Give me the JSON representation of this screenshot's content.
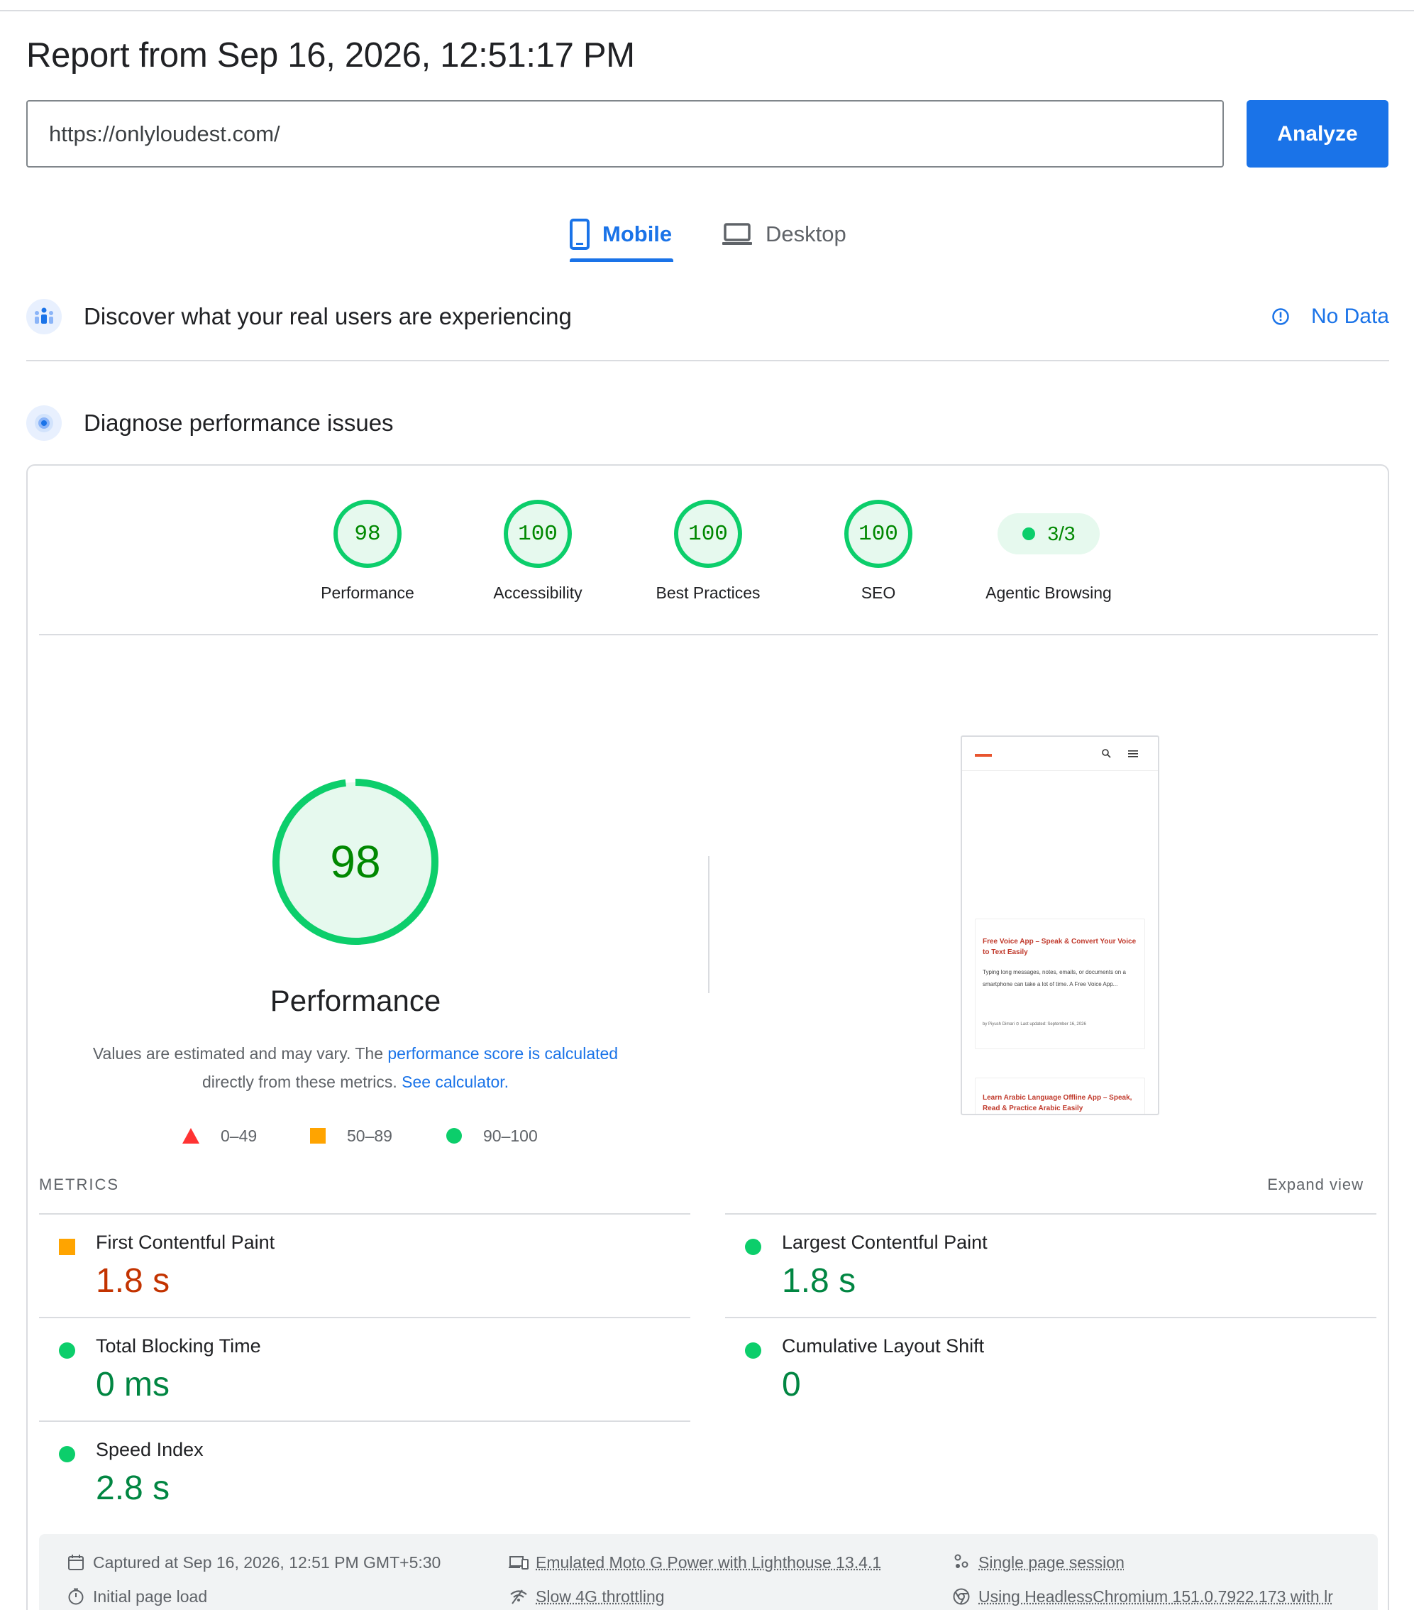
{
  "report": {
    "title": "Report from Sep 16, 2026, 12:51:17 PM"
  },
  "url_input": {
    "value": "https://onlyloudest.com/"
  },
  "analyze_button": "Analyze",
  "tabs": {
    "mobile": "Mobile",
    "desktop": "Desktop",
    "active": "Mobile"
  },
  "field_data": {
    "title": "Discover what your real users are experiencing",
    "status": "No Data"
  },
  "diagnose": {
    "title": "Diagnose performance issues"
  },
  "scores": {
    "performance": {
      "value": "98",
      "label": "Performance"
    },
    "accessibility": {
      "value": "100",
      "label": "Accessibility"
    },
    "best_practices": {
      "value": "100",
      "label": "Best Practices"
    },
    "seo": {
      "value": "100",
      "label": "SEO"
    },
    "agentic": {
      "value": "3/3",
      "label": "Agentic Browsing"
    }
  },
  "performance_detail": {
    "score": "98",
    "score_fraction": 0.98,
    "title": "Performance",
    "desc_1": "Values are estimated and may vary. The ",
    "desc_link_1": "performance score is calculated",
    "desc_2": "directly from these metrics. ",
    "desc_link_2": "See calculator."
  },
  "legend": {
    "fail": "0–49",
    "average": "50–89",
    "pass": "90–100"
  },
  "screenshot_preview": {
    "card1_title": "Free Voice App – Speak & Convert Your Voice to Text Easily",
    "card1_text": "Typing long messages, notes, emails, or documents on a smartphone can take a lot of time. A Free Voice App...",
    "card1_meta": "by Piyush Dimari   ⊙ Last updated: September 16, 2026",
    "card2_title": "Learn Arabic Language Offline App – Speak, Read & Practice Arabic Easily"
  },
  "metrics": {
    "heading": "METRICS",
    "expand": "Expand view",
    "fcp": {
      "label": "First Contentful Paint",
      "value": "1.8 s"
    },
    "lcp": {
      "label": "Largest Contentful Paint",
      "value": "1.8 s"
    },
    "tbt": {
      "label": "Total Blocking Time",
      "value": "0 ms"
    },
    "cls": {
      "label": "Cumulative Layout Shift",
      "value": "0"
    },
    "si": {
      "label": "Speed Index",
      "value": "2.8 s"
    }
  },
  "footer": {
    "captured": "Captured at Sep 16, 2026, 12:51 PM GMT+5:30",
    "initial_load": "Initial page load",
    "emulated": "Emulated Moto G Power with Lighthouse 13.4.1",
    "throttling": "Slow 4G throttling",
    "session": "Single page session",
    "browser": "Using HeadlessChromium 151.0.7922.173 with lr"
  },
  "colors": {
    "accent": "#1a73e8",
    "pass": "#0cce6b",
    "average": "#ffa400",
    "fail": "#ff3333"
  }
}
